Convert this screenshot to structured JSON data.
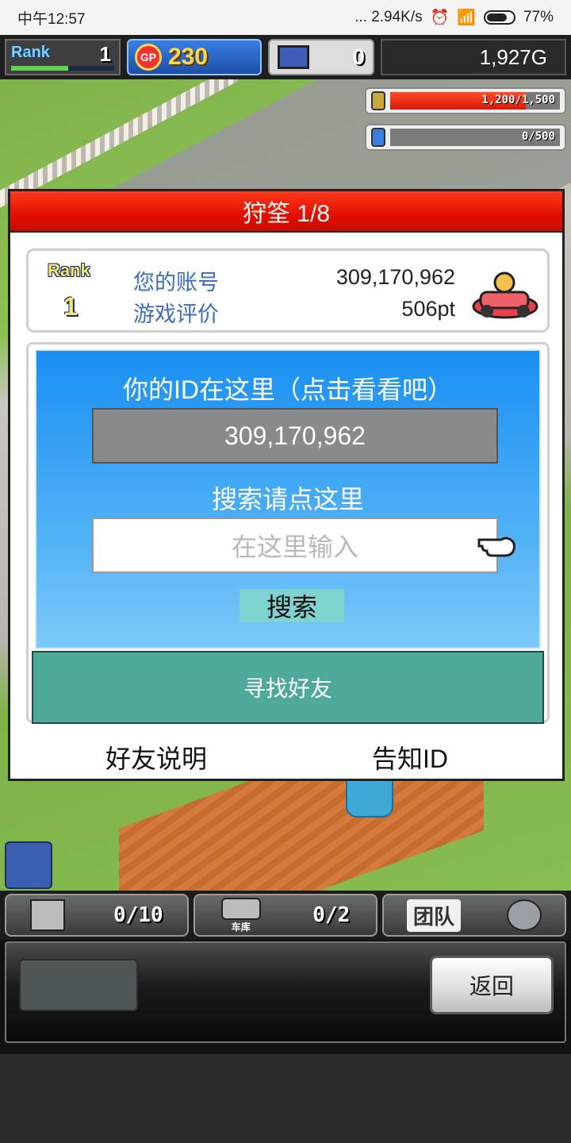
{
  "status_bar": {
    "time": "中午12:57",
    "network": "... 2.94K/s",
    "battery": "77%"
  },
  "hud": {
    "rank_label": "Rank",
    "rank_value": "1",
    "gp_icon_text": "GP",
    "gp_value": "230",
    "pc_value": "0",
    "money": "1,927G"
  },
  "meters": {
    "coins": "1,200/1,500",
    "research": "0/500"
  },
  "dialog": {
    "title": "狩筌 1/8",
    "rank_label": "Rank",
    "rank_value": "1",
    "account_label": "您的账号",
    "account_value": "309,170,962",
    "rating_label": "游戏评价",
    "rating_value": "506pt",
    "id_hint": "你的ID在这里（点击看看吧）",
    "id_value": "309,170,962",
    "search_hint": "搜索请点这里",
    "search_placeholder": "在这里输入",
    "search_button": "搜索",
    "find_friend": "寻找好友",
    "friend_help": "好友说明",
    "share_id": "告知ID"
  },
  "bottom": {
    "tab1_count": "0/10",
    "tab2_label": "车库",
    "tab2_count": "0/2",
    "team_label": "团队",
    "back_button": "返回"
  },
  "colors": {
    "header_red": "#e10f00",
    "panel_blue": "#1a8ff2",
    "find_friend_green": "#4fa99a",
    "label_blue": "#3b6cc0"
  }
}
